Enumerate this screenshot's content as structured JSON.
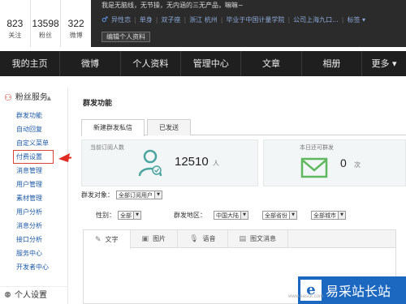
{
  "profile": {
    "stats": [
      {
        "num": "823",
        "label": "关注"
      },
      {
        "num": "13598",
        "label": "粉丝"
      },
      {
        "num": "322",
        "label": "微博"
      }
    ],
    "motto": "我是无脑线，无节操，无内涵的三无产品，嘛嘛~",
    "info": [
      "异性恋",
      "单身",
      "双子座",
      "浙江 杭州",
      "毕业于中国计量学院",
      "公司上海九口..."
    ],
    "tags_label": "标签",
    "edit_button": "编辑个人资料"
  },
  "nav": {
    "items": [
      "我的主页",
      "微博",
      "个人资料",
      "管理中心",
      "文章",
      "相册"
    ],
    "more": "更多"
  },
  "sidebar": {
    "section_title": "粉丝服务",
    "items": [
      "群发功能",
      "自动回复",
      "自定义菜单",
      "付费设置",
      "消息管理",
      "用户管理",
      "素材管理",
      "用户分析",
      "消息分析",
      "接口分析",
      "服务中心",
      "开发者中心"
    ],
    "active_index": 3,
    "next_section": "个人设置"
  },
  "content": {
    "title": "群发功能",
    "tabs": [
      "新建群发私信",
      "已发送"
    ],
    "subscribers_label": "当前订阅人数",
    "subscribers_count": "12510",
    "subscribers_unit": "人",
    "remaining_label": "本日还可群发",
    "remaining_count": "0",
    "remaining_unit": "次",
    "target_label": "群发对象：",
    "target_value": "全部订阅用户",
    "gender_label": "性别：",
    "gender_value": "全部",
    "region_label": "群发地区：",
    "country_value": "中国大陆",
    "province_value": "全部省份",
    "city_value": "全部城市",
    "editor_tabs": [
      "文字",
      "图片",
      "语音",
      "图文消息"
    ]
  },
  "watermark": {
    "logo": "e",
    "text": "易采站长站",
    "url": "www.easck.com"
  },
  "colors": {
    "nav_bg": "#1f1f1f",
    "link": "#1d5aa5",
    "highlight": "#d9453a",
    "accent_icon": "#4aa4a0",
    "watermark": "#1c68c1"
  }
}
